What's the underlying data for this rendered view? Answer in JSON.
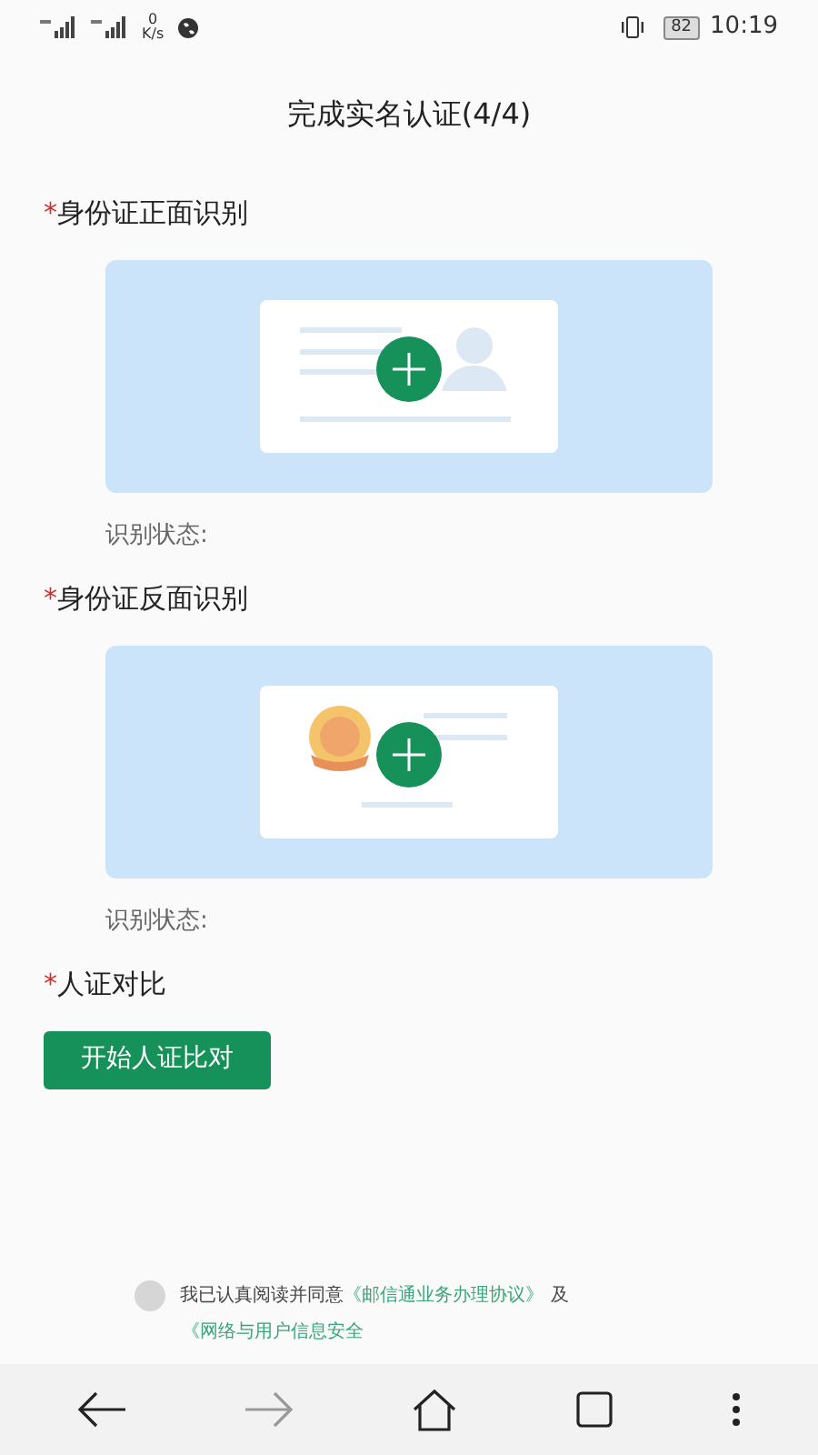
{
  "status_bar": {
    "network_speed": "0",
    "speed_unit": "K/s",
    "battery": "82",
    "time": "10:19"
  },
  "title": "完成实名认证(4/4)",
  "sections": [
    {
      "kind": "upload_front",
      "required_mark": "*",
      "label": "身份证正面识别",
      "status_label": "识别状态:"
    },
    {
      "kind": "upload_back",
      "required_mark": "*",
      "label": "身份证反面识别",
      "status_label": "识别状态:"
    },
    {
      "kind": "button",
      "required_mark": "*",
      "label": "人证对比",
      "button": "开始人证比对"
    }
  ],
  "agreement": {
    "checked": false,
    "text": "我已认真阅读并同意",
    "link_1": "《邮信通业务办理协议》",
    "conjunction": "及",
    "link_2": "《网络与用户信息安全"
  }
}
